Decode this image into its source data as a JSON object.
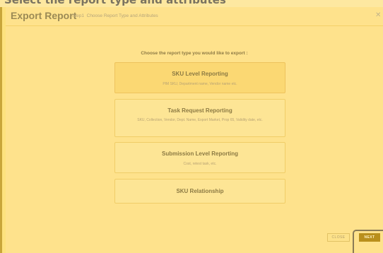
{
  "background_caption": "Select the report type and attributes",
  "modal": {
    "title": "Export Report",
    "step": "Step1",
    "subtitle": "Choose Report Type and Attributes",
    "close_icon": "close-icon"
  },
  "prompt": "Choose the report type you would like to export :",
  "options": [
    {
      "title": "SKU Level Reporting",
      "description": "PIM SKU, Department name, Vendor name etc.",
      "selected": true
    },
    {
      "title": "Task Request Reporting",
      "description": "SKU, Collection, Vendor, Dept. Name, Export Market, Prop 65, Validity date, etc.",
      "selected": false
    },
    {
      "title": "Submission Level Reporting",
      "description": "Cost, retest task, etc.",
      "selected": false
    },
    {
      "title": "SKU Relationship",
      "description": "",
      "selected": false
    }
  ],
  "footer": {
    "close_label": "CLOSE",
    "next_label": "NEXT"
  },
  "colors": {
    "accent": "#b98f1c",
    "background": "#fde27e"
  }
}
